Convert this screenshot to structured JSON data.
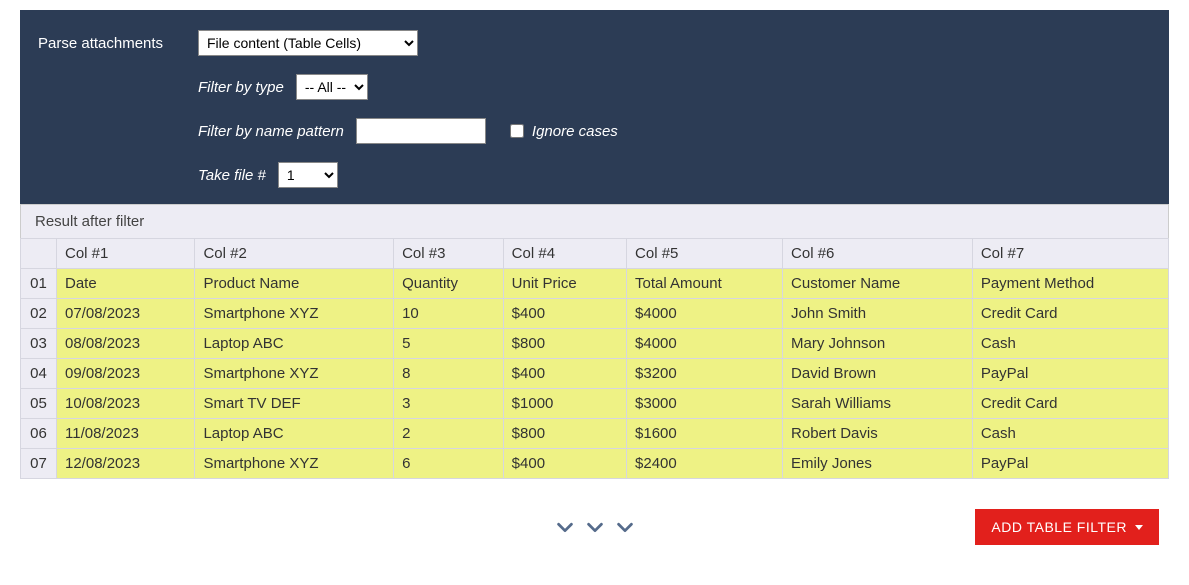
{
  "panel": {
    "parse_label": "Parse attachments",
    "parse_value": "File content (Table Cells)",
    "filter_type_label": "Filter by type",
    "filter_type_value": "-- All --",
    "filter_name_label": "Filter by name pattern",
    "filter_name_value": "",
    "filter_name_placeholder": "",
    "ignore_cases_label": "Ignore cases",
    "take_file_label": "Take file #",
    "take_file_value": "1"
  },
  "result_header": "Result after filter",
  "columns": [
    "",
    "Col #1",
    "Col #2",
    "Col #3",
    "Col #4",
    "Col #5",
    "Col #6",
    "Col #7"
  ],
  "rows": [
    {
      "num": "01",
      "cells": [
        "Date",
        "Product Name",
        "Quantity",
        "Unit Price",
        "Total Amount",
        "Customer Name",
        "Payment Method"
      ]
    },
    {
      "num": "02",
      "cells": [
        "07/08/2023",
        "Smartphone XYZ",
        "10",
        "$400",
        "$4000",
        "John Smith",
        "Credit Card"
      ]
    },
    {
      "num": "03",
      "cells": [
        "08/08/2023",
        "Laptop ABC",
        "5",
        "$800",
        "$4000",
        "Mary Johnson",
        "Cash"
      ]
    },
    {
      "num": "04",
      "cells": [
        "09/08/2023",
        "Smartphone XYZ",
        "8",
        "$400",
        "$3200",
        "David Brown",
        "PayPal"
      ]
    },
    {
      "num": "05",
      "cells": [
        "10/08/2023",
        "Smart TV DEF",
        "3",
        "$1000",
        "$3000",
        "Sarah Williams",
        "Credit Card"
      ]
    },
    {
      "num": "06",
      "cells": [
        "11/08/2023",
        "Laptop ABC",
        "2",
        "$800",
        "$1600",
        "Robert Davis",
        "Cash"
      ]
    },
    {
      "num": "07",
      "cells": [
        "12/08/2023",
        "Smartphone XYZ",
        "6",
        "$400",
        "$2400",
        "Emily Jones",
        "PayPal"
      ]
    }
  ],
  "add_btn": "ADD TABLE FILTER"
}
